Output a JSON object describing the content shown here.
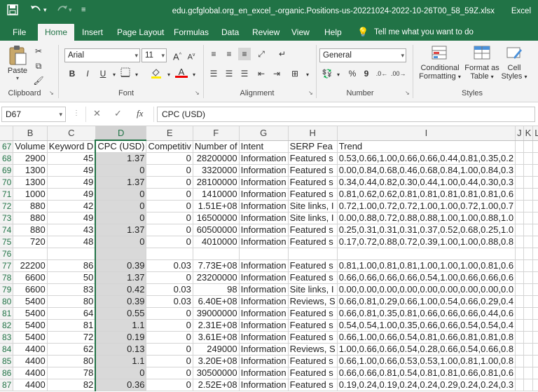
{
  "titlebar": {
    "filename": "edu.gcfglobal.org_en_excel_-organic.Positions-us-20221024-2022-10-26T00_58_59Z.xlsx",
    "app": "Excel",
    "save_icon": "save-icon",
    "undo_icon": "undo-icon",
    "redo_icon": "redo-icon"
  },
  "tabs": [
    "File",
    "Home",
    "Insert",
    "Page Layout",
    "Formulas",
    "Data",
    "Review",
    "View",
    "Help"
  ],
  "active_tab": "Home",
  "tell_me": "Tell me what you want to do",
  "ribbon": {
    "clipboard": {
      "label": "Clipboard",
      "paste": "Paste"
    },
    "font": {
      "label": "Font",
      "font_name": "Arial",
      "font_size": "11"
    },
    "alignment": {
      "label": "Alignment"
    },
    "number": {
      "label": "Number",
      "format": "General"
    },
    "styles": {
      "label": "Styles",
      "conditional": [
        "Conditional",
        "Formatting"
      ],
      "format_table": [
        "Format as",
        "Table"
      ],
      "cell_styles": [
        "Cell",
        "Styles"
      ]
    }
  },
  "formula_bar": {
    "name_box": "D67",
    "content": "CPC (USD)"
  },
  "sheet": {
    "columns": [
      "B",
      "C",
      "D",
      "E",
      "F",
      "G",
      "H",
      "I",
      "J",
      "K",
      "L"
    ],
    "selected_column": "D",
    "rows": [
      {
        "n": "67",
        "cells": [
          "Volume",
          "Keyword D",
          "CPC (USD)",
          "Competitiv",
          "Number of",
          "Intent",
          "SERP Fea",
          "Trend",
          "",
          "",
          ""
        ]
      },
      {
        "n": "68",
        "cells": [
          "2900",
          "45",
          "1.37",
          "0",
          "28200000",
          "Information",
          "Featured s",
          "0.53,0.66,1.00,0.66,0.66,0.44,0.81,0.35,0.2",
          "",
          "",
          ""
        ]
      },
      {
        "n": "69",
        "cells": [
          "1300",
          "49",
          "0",
          "0",
          "3320000",
          "Information",
          "Featured s",
          "0.00,0.84,0.68,0.46,0.68,0.84,1.00,0.84,0.3",
          "",
          "",
          ""
        ]
      },
      {
        "n": "70",
        "cells": [
          "1300",
          "49",
          "1.37",
          "0",
          "28100000",
          "Information",
          "Featured s",
          "0.34,0.44,0.82,0.30,0.44,1.00,0.44,0.30,0.3",
          "",
          "",
          ""
        ]
      },
      {
        "n": "71",
        "cells": [
          "1000",
          "49",
          "0",
          "0",
          "1410000",
          "Information",
          "Featured s",
          "0.81,0.62,0.62,0.81,0.81,0.81,0.81,0.81,0.6",
          "",
          "",
          ""
        ]
      },
      {
        "n": "72",
        "cells": [
          "880",
          "42",
          "0",
          "0",
          "1.51E+08",
          "Information",
          "Site links, I",
          "0.72,1.00,0.72,0.72,1.00,1.00,0.72,1.00,0.7",
          "",
          "",
          ""
        ]
      },
      {
        "n": "73",
        "cells": [
          "880",
          "49",
          "0",
          "0",
          "16500000",
          "Information",
          "Site links, I",
          "0.00,0.88,0.72,0.88,0.88,1.00,1.00,0.88,1.0",
          "",
          "",
          ""
        ]
      },
      {
        "n": "74",
        "cells": [
          "880",
          "43",
          "1.37",
          "0",
          "60500000",
          "Information",
          "Featured s",
          "0.25,0.31,0.31,0.31,0.37,0.52,0.68,0.25,1.0",
          "",
          "",
          ""
        ]
      },
      {
        "n": "75",
        "cells": [
          "720",
          "48",
          "0",
          "0",
          "4010000",
          "Information",
          "Featured s",
          "0.17,0.72,0.88,0.72,0.39,1.00,1.00,0.88,0.8",
          "",
          "",
          ""
        ]
      },
      {
        "n": "76",
        "cells": [
          "",
          "",
          "",
          "",
          "",
          "",
          "",
          "",
          "",
          "",
          ""
        ]
      },
      {
        "n": "77",
        "cells": [
          "22200",
          "86",
          "0.39",
          "0.03",
          "7.73E+08",
          "Information",
          "Featured s",
          "0.81,1.00,0.81,0.81,1.00,1.00,1.00,0.81,0.6",
          "",
          "",
          ""
        ]
      },
      {
        "n": "78",
        "cells": [
          "6600",
          "50",
          "1.37",
          "0",
          "23200000",
          "Information",
          "Featured s",
          "0.66,0.66,0.66,0.66,0.54,1.00,0.66,0.66,0.6",
          "",
          "",
          ""
        ]
      },
      {
        "n": "79",
        "cells": [
          "6600",
          "83",
          "0.42",
          "0.03",
          "98",
          "Information",
          "Site links, I",
          "0.00,0.00,0.00,0.00,0.00,0.00,0.00,0.00,0.0",
          "",
          "",
          ""
        ]
      },
      {
        "n": "80",
        "cells": [
          "5400",
          "80",
          "0.39",
          "0.03",
          "6.40E+08",
          "Information",
          "Reviews, S",
          "0.66,0.81,0.29,0.66,1.00,0.54,0.66,0.29,0.4",
          "",
          "",
          ""
        ]
      },
      {
        "n": "81",
        "cells": [
          "5400",
          "64",
          "0.55",
          "0",
          "39000000",
          "Information",
          "Featured s",
          "0.66,0.81,0.35,0.81,0.66,0.66,0.66,0.44,0.6",
          "",
          "",
          ""
        ]
      },
      {
        "n": "82",
        "cells": [
          "5400",
          "81",
          "1.1",
          "0",
          "2.31E+08",
          "Information",
          "Featured s",
          "0.54,0.54,1.00,0.35,0.66,0.66,0.54,0.54,0.4",
          "",
          "",
          ""
        ]
      },
      {
        "n": "83",
        "cells": [
          "5400",
          "72",
          "0.19",
          "0",
          "3.61E+08",
          "Information",
          "Featured s",
          "0.66,1.00,0.66,0.54,0.81,0.66,0.81,0.81,0.8",
          "",
          "",
          ""
        ]
      },
      {
        "n": "84",
        "cells": [
          "4400",
          "62",
          "0.13",
          "0",
          "249000",
          "Information",
          "Reviews, S",
          "1.00,0.66,0.66,0.54,0.28,0.66,0.54,0.66,0.8",
          "",
          "",
          ""
        ]
      },
      {
        "n": "85",
        "cells": [
          "4400",
          "80",
          "1.1",
          "0",
          "3.20E+08",
          "Information",
          "Featured s",
          "0.66,1.00,0.66,0.53,0.53,1.00,0.81,1.00,0.8",
          "",
          "",
          ""
        ]
      },
      {
        "n": "86",
        "cells": [
          "4400",
          "78",
          "0",
          "0",
          "30500000",
          "Information",
          "Featured s",
          "0.66,0.66,0.81,0.54,0.81,0.81,0.66,0.81,0.6",
          "",
          "",
          ""
        ]
      },
      {
        "n": "87",
        "cells": [
          "4400",
          "82",
          "0.36",
          "0",
          "2.52E+08",
          "Information",
          "Featured s",
          "0.19,0.24,0.19,0.24,0.24,0.29,0.24,0.24,0.3",
          "",
          "",
          ""
        ]
      }
    ]
  }
}
